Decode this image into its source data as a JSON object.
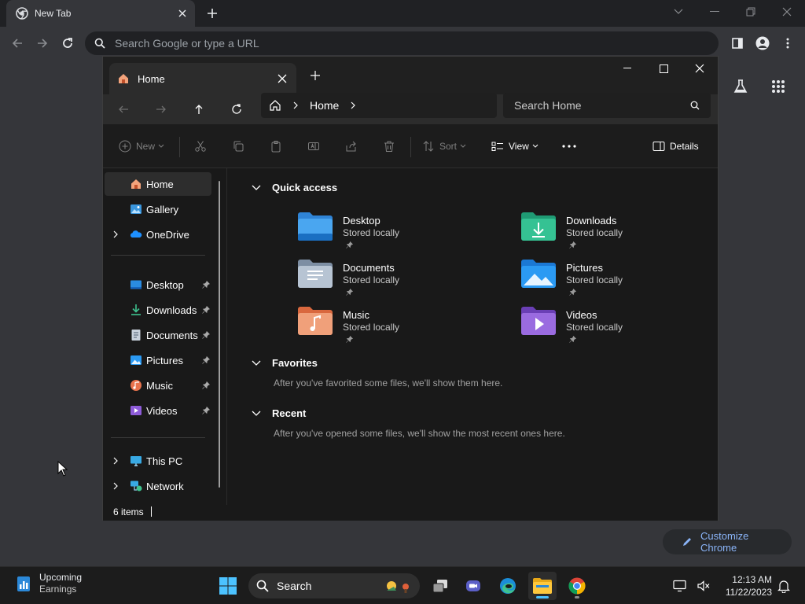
{
  "chrome": {
    "tab_title": "New Tab",
    "omnibox_placeholder": "Search Google or type a URL",
    "customize_label": "Customize Chrome"
  },
  "explorer": {
    "tab_title": "Home",
    "breadcrumb": "Home",
    "search_placeholder": "Search Home",
    "commands": {
      "new": "New",
      "sort": "Sort",
      "view": "View",
      "details": "Details"
    },
    "sidebar": {
      "home": "Home",
      "gallery": "Gallery",
      "onedrive": "OneDrive",
      "pinned": [
        "Desktop",
        "Downloads",
        "Documents",
        "Pictures",
        "Music",
        "Videos"
      ],
      "this_pc": "This PC",
      "network": "Network"
    },
    "sections": {
      "quick_access": "Quick access",
      "favorites": "Favorites",
      "favorites_empty": "After you've favorited some files, we'll show them here.",
      "recent": "Recent",
      "recent_empty": "After you've opened some files, we'll show the most recent ones here."
    },
    "quick_access_items": [
      {
        "name": "Desktop",
        "status": "Stored locally"
      },
      {
        "name": "Downloads",
        "status": "Stored locally"
      },
      {
        "name": "Documents",
        "status": "Stored locally"
      },
      {
        "name": "Pictures",
        "status": "Stored locally"
      },
      {
        "name": "Music",
        "status": "Stored locally"
      },
      {
        "name": "Videos",
        "status": "Stored locally"
      }
    ],
    "status": "6 items"
  },
  "taskbar": {
    "widget_title": "Upcoming",
    "widget_sub": "Earnings",
    "search_label": "Search",
    "time": "12:13 AM",
    "date": "11/22/2023"
  },
  "colors": {
    "accent": "#4cc2ff",
    "chrome_link": "#8ab4f8"
  }
}
